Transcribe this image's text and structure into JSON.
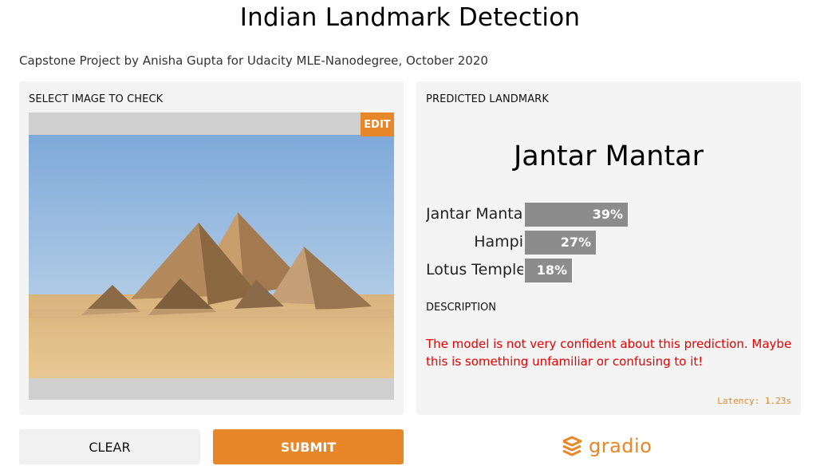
{
  "app": {
    "title": "Indian Landmark Detection",
    "subtitle": "Capstone Project by Anisha Gupta for Udacity MLE-Nanodegree, October 2020"
  },
  "input_panel": {
    "label": "SELECT IMAGE TO CHECK",
    "edit_label": "EDIT",
    "image_alt": "pyramids-photo"
  },
  "output_panel": {
    "label": "PREDICTED LANDMARK",
    "predicted": "Jantar Mantar",
    "confidences": [
      {
        "label": "Jantar Mantar",
        "percent": "39%",
        "value": 0.39
      },
      {
        "label": "Hampi",
        "percent": "27%",
        "value": 0.27
      },
      {
        "label": "Lotus Temple",
        "percent": "18%",
        "value": 0.18
      }
    ],
    "description_label": "DESCRIPTION",
    "description": "The model is not very confident about this prediction. Maybe this is something unfamiliar or confusing to it!",
    "latency": "Latency: 1.23s"
  },
  "actions": {
    "clear_label": "CLEAR",
    "submit_label": "SUBMIT"
  },
  "branding": {
    "name": "gradio",
    "icon": "gradio-logo-icon",
    "accent": "#e8862a"
  },
  "colors": {
    "accent": "#e8862a",
    "warning": "#e60000",
    "bar": "#8c8c8c"
  }
}
